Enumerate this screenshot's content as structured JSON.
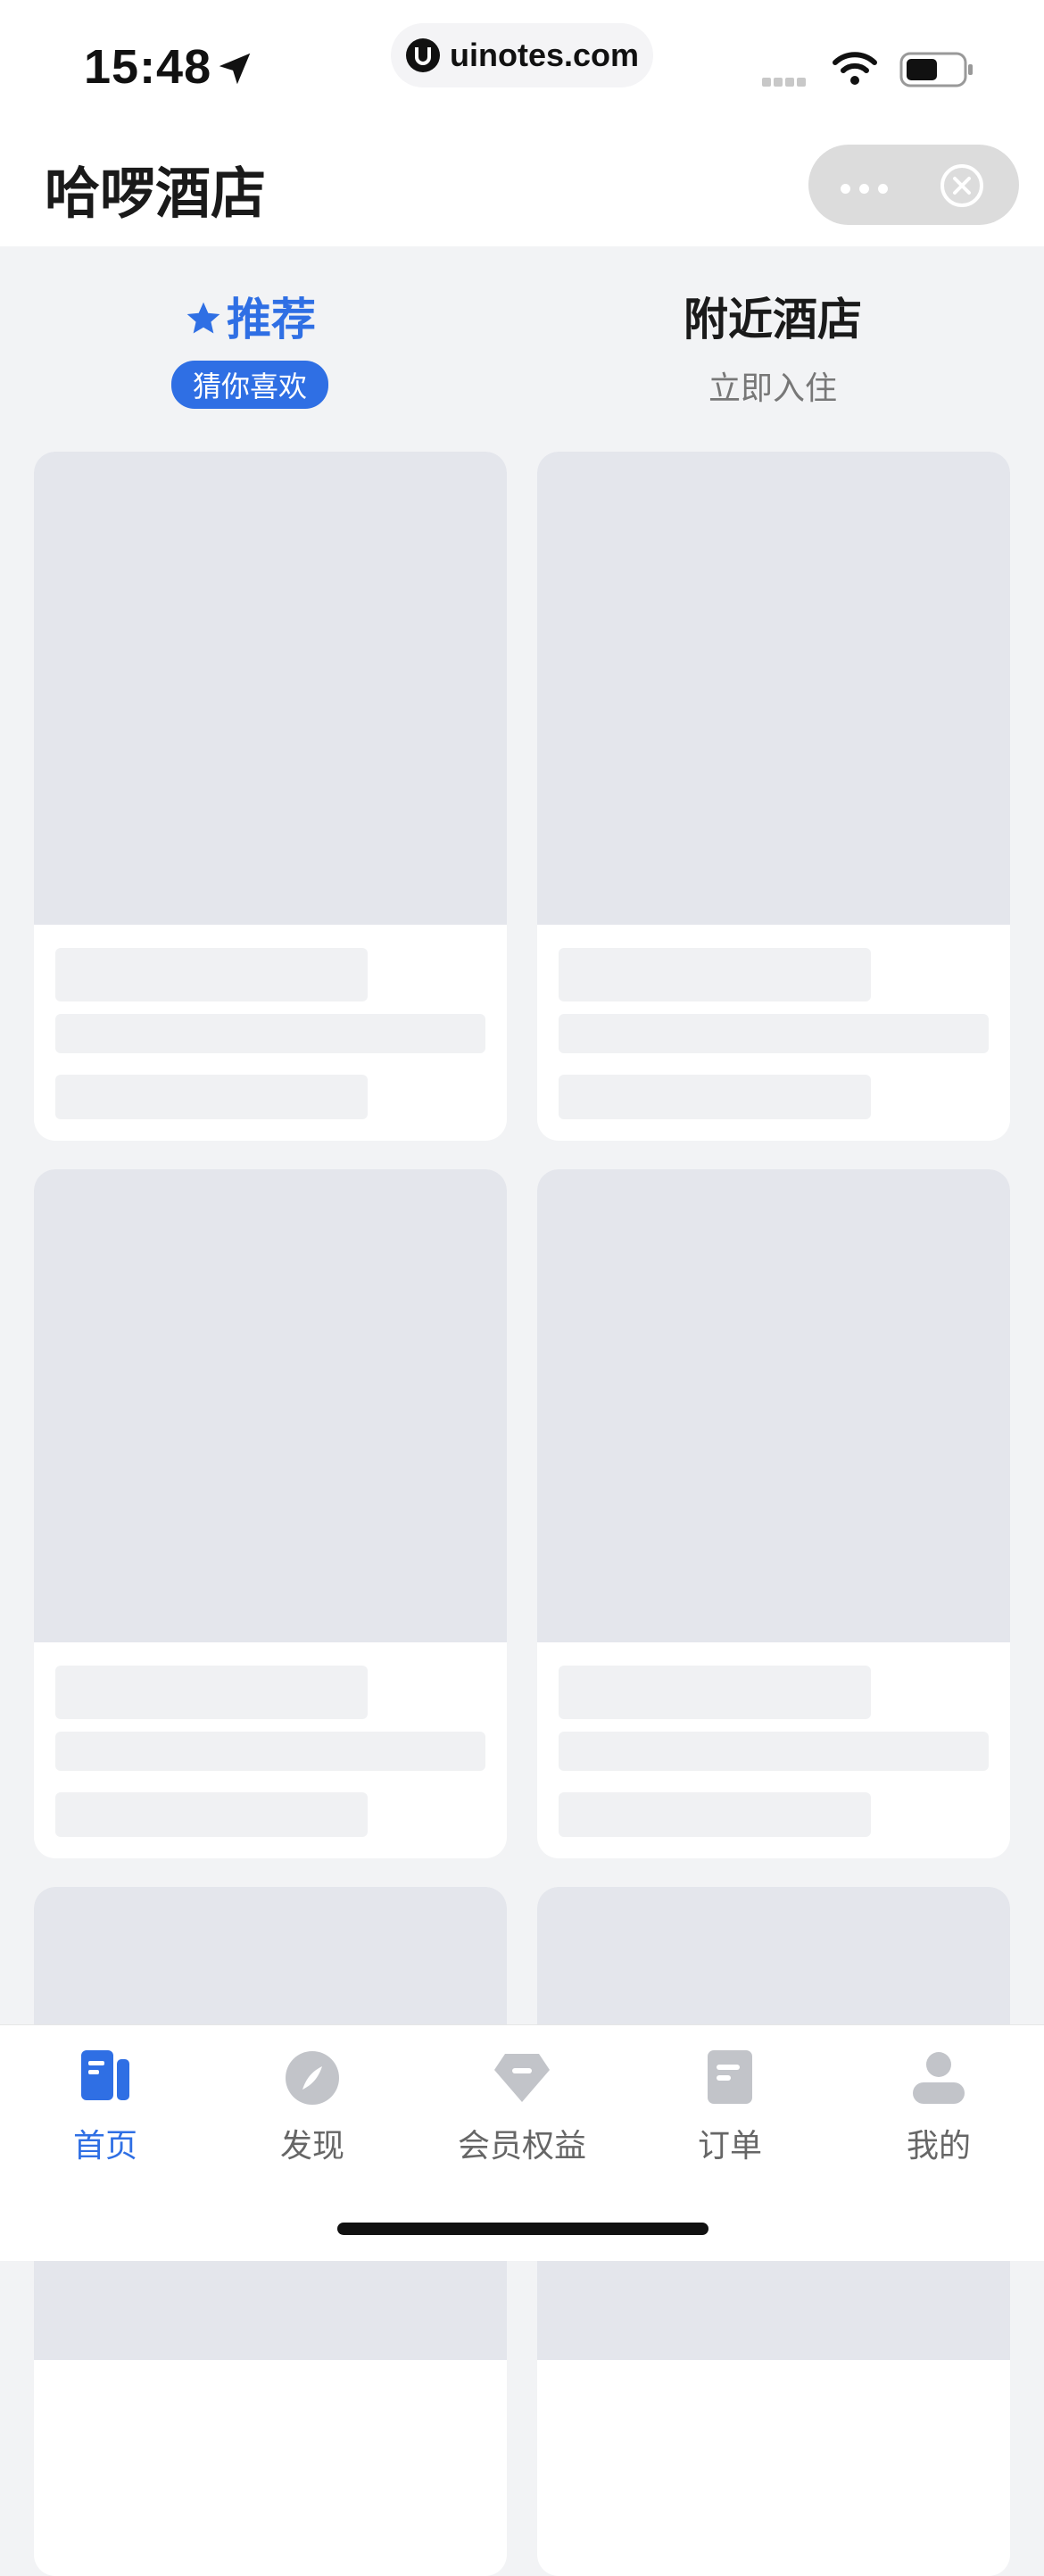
{
  "status_bar": {
    "time": "15:48",
    "url": "uinotes.com"
  },
  "header": {
    "title": "哈啰酒店"
  },
  "tabs": [
    {
      "title": "推荐",
      "subtitle": "猜你喜欢",
      "active": true
    },
    {
      "title": "附近酒店",
      "subtitle": "立即入住",
      "active": false
    }
  ],
  "bottom_nav": [
    {
      "label": "首页",
      "icon": "home-icon",
      "active": true
    },
    {
      "label": "发现",
      "icon": "compass-icon",
      "active": false
    },
    {
      "label": "会员权益",
      "icon": "diamond-icon",
      "active": false
    },
    {
      "label": "订单",
      "icon": "order-icon",
      "active": false
    },
    {
      "label": "我的",
      "icon": "user-icon",
      "active": false
    }
  ],
  "colors": {
    "accent": "#2f6fe4",
    "skeleton_image": "#e4e6ec",
    "skeleton_line": "#f0f1f3",
    "background": "#f2f3f5"
  }
}
